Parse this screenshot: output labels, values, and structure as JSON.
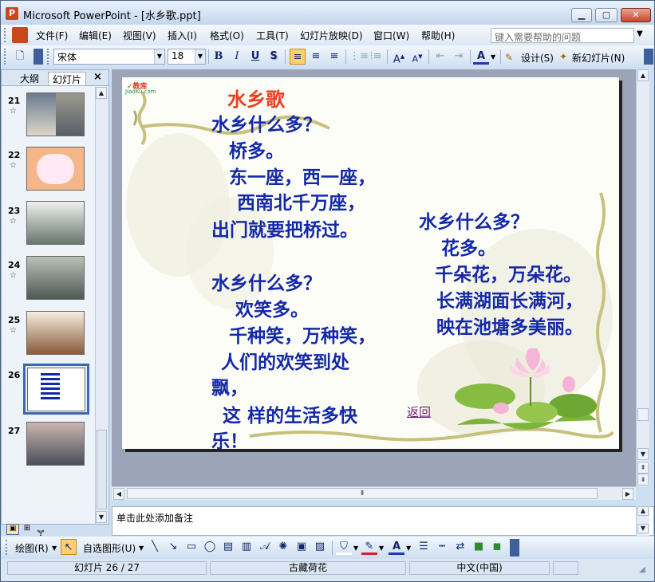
{
  "window": {
    "title": "Microsoft PowerPoint - [水乡歌.ppt]",
    "app_icon": "P"
  },
  "menu": {
    "items": [
      "文件(F)",
      "编辑(E)",
      "视图(V)",
      "插入(I)",
      "格式(O)",
      "工具(T)",
      "幻灯片放映(D)",
      "窗口(W)",
      "帮助(H)"
    ],
    "help_placeholder": "键入需要帮助的问题"
  },
  "toolbar": {
    "font_name": "宋体",
    "font_size": "18",
    "bold": "B",
    "italic": "I",
    "underline": "U",
    "shadow": "S",
    "design_label": "设计(S)",
    "new_slide_label": "新幻灯片(N)"
  },
  "left_pane": {
    "tabs": [
      "大纲",
      "幻灯片"
    ],
    "active_tab": "幻灯片",
    "close_symbol": "×",
    "slides": [
      {
        "number": "21",
        "has_star": true
      },
      {
        "number": "22",
        "has_star": true
      },
      {
        "number": "23",
        "has_star": true
      },
      {
        "number": "24",
        "has_star": true
      },
      {
        "number": "25",
        "has_star": true
      },
      {
        "number": "26",
        "has_star": false,
        "selected": true
      },
      {
        "number": "27",
        "has_star": false
      }
    ]
  },
  "slide": {
    "logo_text": "JiaoKu.com",
    "title": "水乡歌",
    "left_lines": [
      "水乡什么多？",
      "桥多。",
      "东一座，西一座，",
      "西南北千万座，",
      "出门就要把桥过。",
      "水乡什么多？",
      "欢笑多。",
      "千种笑，万种笑，",
      "人们的欢笑到处",
      "飘，",
      "这 样的生活多快",
      "乐！"
    ],
    "right_lines": [
      "水乡什么多？",
      "花多。",
      "千朵花，万朵花。",
      "长满湖面长满河，",
      "映在池塘多美丽。"
    ],
    "back_link": "返回"
  },
  "notes": {
    "placeholder": "单击此处添加备注"
  },
  "draw_toolbar": {
    "draw_label": "绘图(R)",
    "autoshape_label": "自选图形(U)"
  },
  "status": {
    "slide_position": "幻灯片 26 / 27",
    "design": "古藏荷花",
    "language": "中文(中国)"
  },
  "colors": {
    "title_red": "#e8401c",
    "body_blue": "#1429a8",
    "link_purple": "#7a1a7a"
  }
}
